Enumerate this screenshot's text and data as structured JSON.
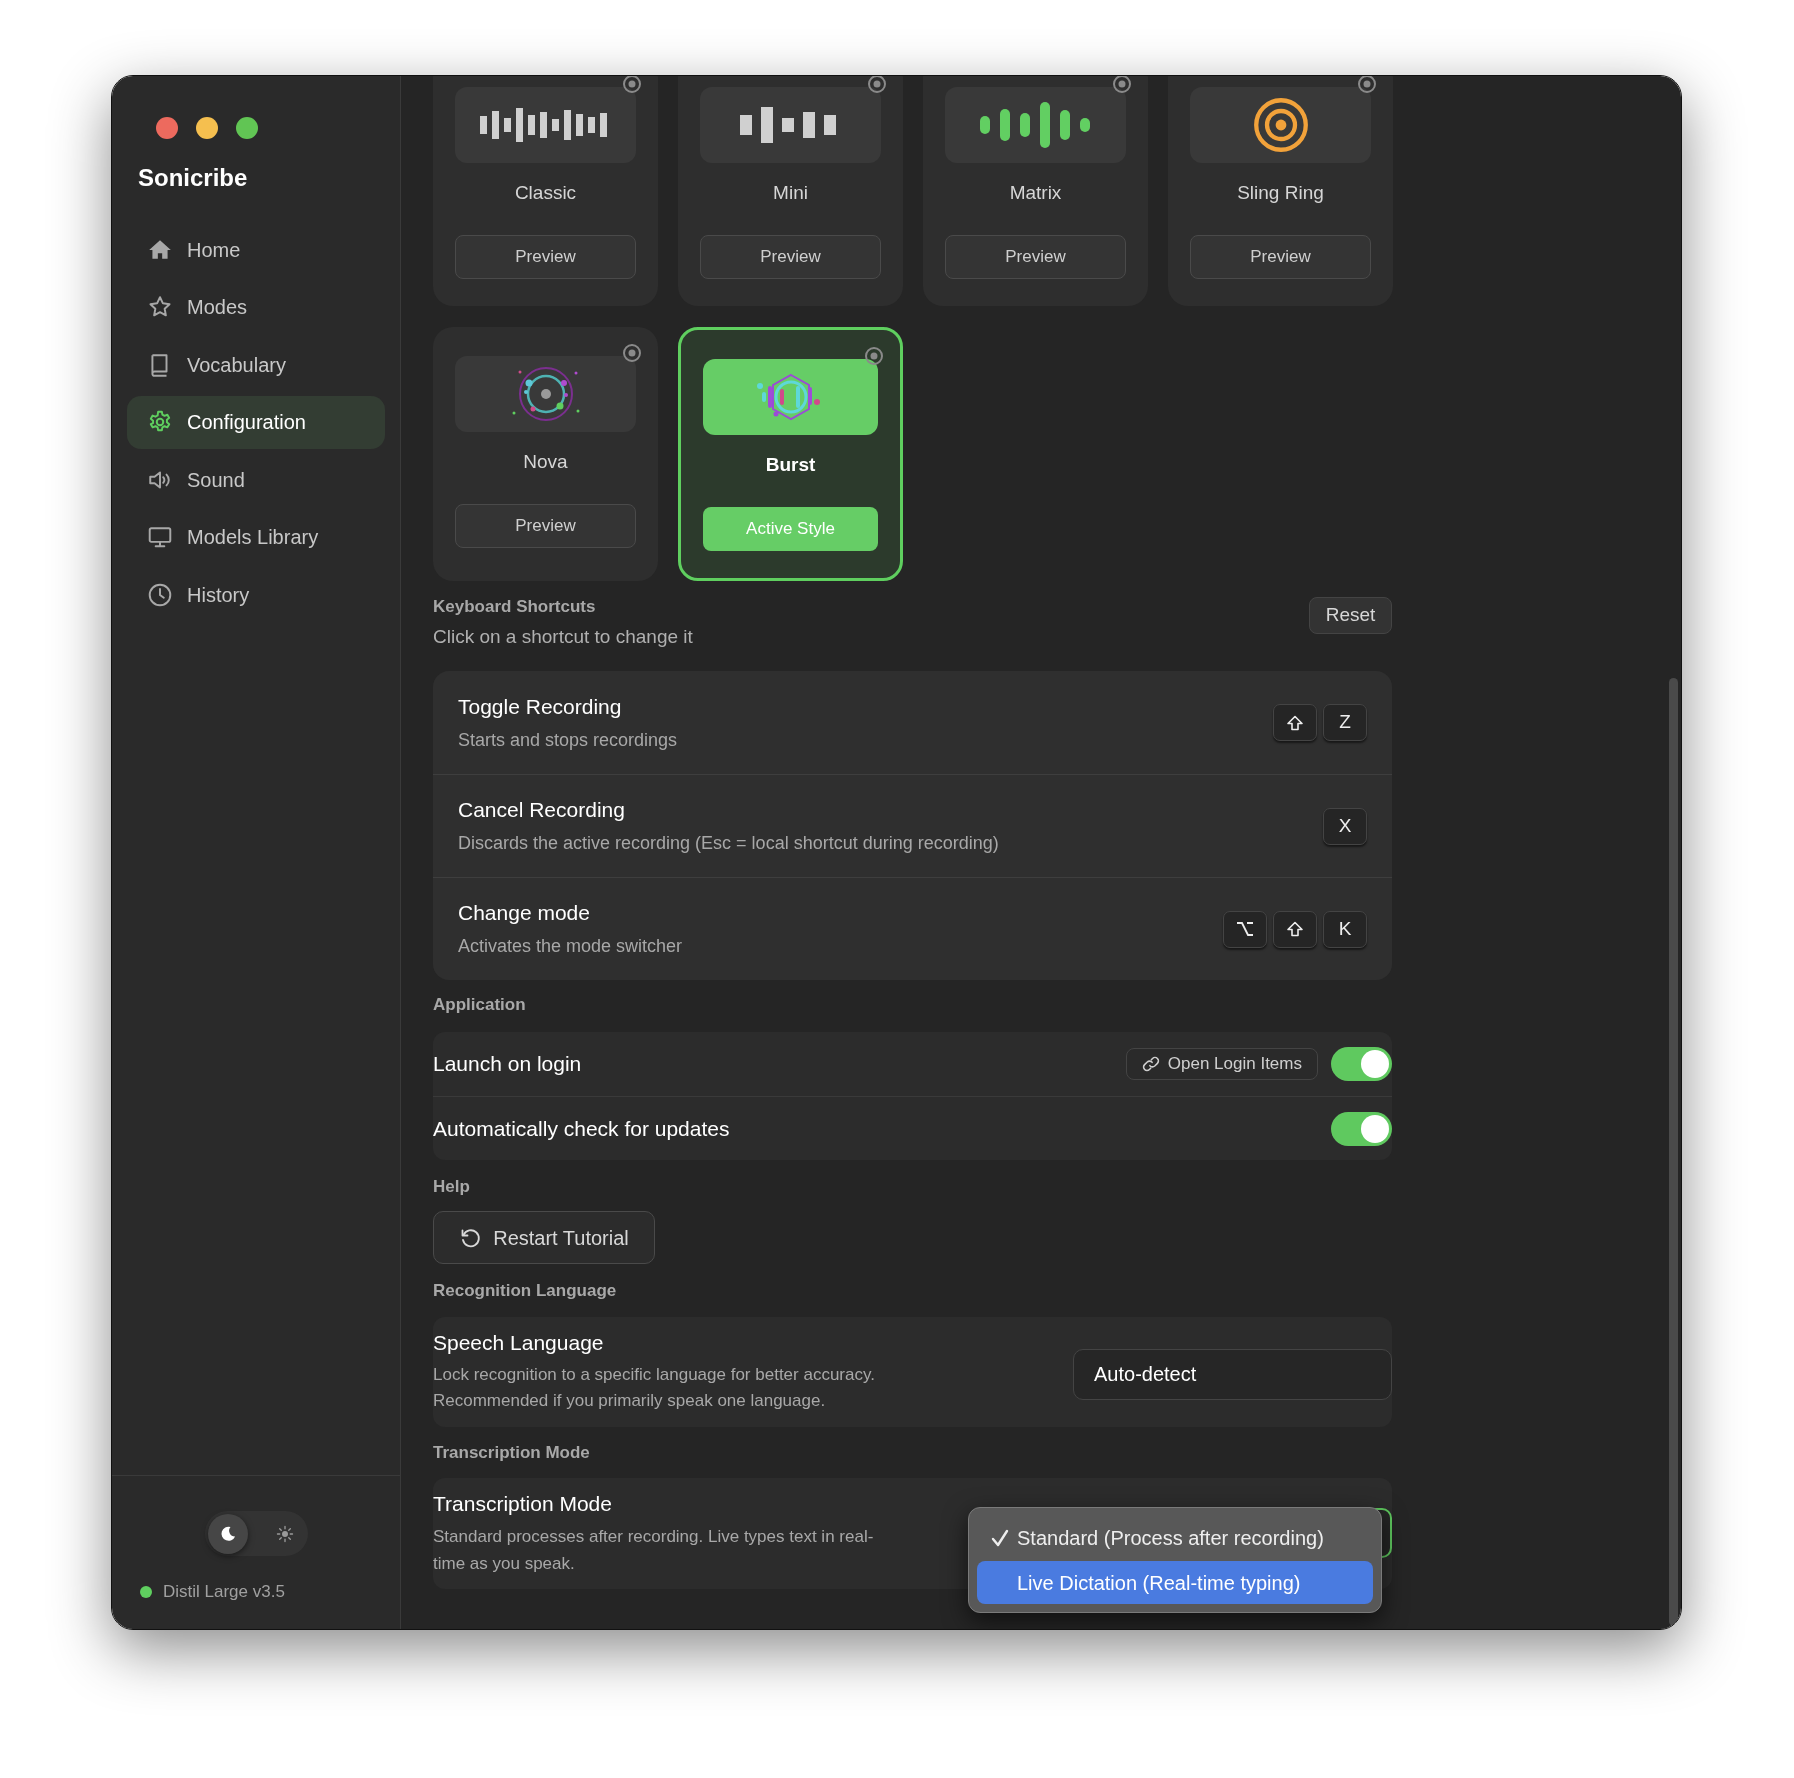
{
  "window": {
    "controls": [
      {
        "color": "#ed6a5e"
      },
      {
        "color": "#f5bf4f"
      },
      {
        "color": "#61c554"
      }
    ]
  },
  "sidebar": {
    "app_name": "Sonicribe",
    "items": [
      {
        "label": "Home",
        "selected": false
      },
      {
        "label": "Modes",
        "selected": false
      },
      {
        "label": "Vocabulary",
        "selected": false
      },
      {
        "label": "Configuration",
        "selected": true
      },
      {
        "label": "Sound",
        "selected": false
      },
      {
        "label": "Models Library",
        "selected": false
      },
      {
        "label": "History",
        "selected": false
      }
    ],
    "theme": [
      {
        "kind": "dark",
        "selected": true
      },
      {
        "kind": "light",
        "selected": false
      }
    ],
    "model_status": {
      "label": "Distil Large v3.5",
      "online": true
    }
  },
  "styles": [
    {
      "name": "Classic",
      "button": "Preview",
      "selected": false
    },
    {
      "name": "Mini",
      "button": "Preview",
      "selected": false
    },
    {
      "name": "Matrix",
      "button": "Preview",
      "selected": false
    },
    {
      "name": "Sling Ring",
      "button": "Preview",
      "selected": false
    },
    {
      "name": "Nova",
      "button": "Preview",
      "selected": false
    },
    {
      "name": "Burst",
      "button": "Active Style",
      "selected": true
    }
  ],
  "keyboard_shortcuts": {
    "heading": "Keyboard Shortcuts",
    "subtitle": "Click on a shortcut to change it",
    "reset": "Reset",
    "items": [
      {
        "title": "Toggle Recording",
        "description": "Starts and stops recordings",
        "keys": [
          {
            "kind": "shift"
          },
          {
            "kind": "char",
            "label": "Z"
          }
        ]
      },
      {
        "title": "Cancel Recording",
        "description": "Discards the active recording (Esc = local shortcut during recording)",
        "keys": [
          {
            "kind": "char",
            "label": "X"
          }
        ]
      },
      {
        "title": "Change mode",
        "description": "Activates the mode switcher",
        "keys": [
          {
            "kind": "option"
          },
          {
            "kind": "shift"
          },
          {
            "kind": "char",
            "label": "K"
          }
        ]
      }
    ]
  },
  "application": {
    "heading": "Application",
    "items": [
      {
        "label": "Launch on login",
        "link": "Open Login Items",
        "on": true
      },
      {
        "label": "Automatically check for updates",
        "on": true
      }
    ]
  },
  "help": {
    "heading": "Help",
    "button": "Restart Tutorial"
  },
  "recognition_language": {
    "heading": "Recognition Language",
    "title": "Speech Language",
    "description": "Lock recognition to a specific language for better accuracy. Recommended if you primarily speak one language.",
    "value": "Auto-detect"
  },
  "transcription_mode": {
    "heading": "Transcription Mode",
    "title": "Transcription Mode",
    "description": "Standard processes after recording. Live types text in real-time as you speak.",
    "options": [
      {
        "label": "Standard (Process after recording)",
        "checked": true,
        "selected": false
      },
      {
        "label": "Live Dictation (Real-time typing)",
        "checked": false,
        "selected": true
      }
    ]
  }
}
